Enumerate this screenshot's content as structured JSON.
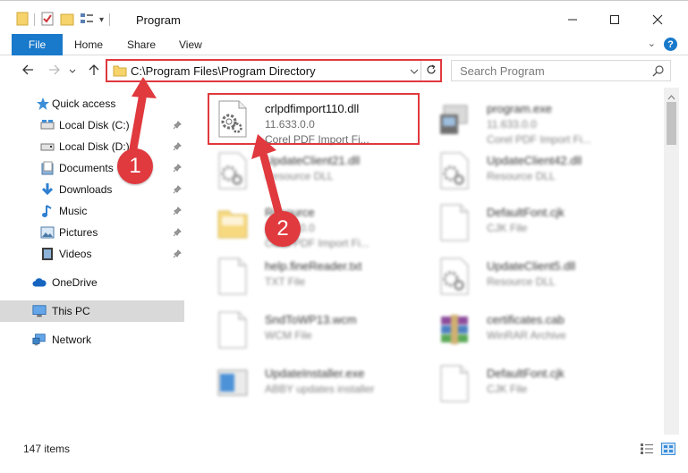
{
  "window": {
    "title": "Program",
    "qat_dropdown": "▾",
    "controls": {
      "minimize": "—",
      "maximize": "☐",
      "close": "✕"
    }
  },
  "ribbon": {
    "file_tab": "File",
    "tabs": [
      "Home",
      "Share",
      "View"
    ],
    "help": "?",
    "expand": "⌄"
  },
  "nav": {
    "address_path": "C:\\Program Files\\Program Directory",
    "search_placeholder": "Search Program"
  },
  "sidebar": {
    "items": [
      {
        "label": "Quick access",
        "icon": "star-icon",
        "pinned": false
      },
      {
        "label": "Local Disk (C:)",
        "icon": "drive-icon",
        "pinned": true
      },
      {
        "label": "Local Disk (D:)",
        "icon": "drive-icon",
        "pinned": true
      },
      {
        "label": "Documents",
        "icon": "documents-icon",
        "pinned": true
      },
      {
        "label": "Downloads",
        "icon": "downloads-icon",
        "pinned": true
      },
      {
        "label": "Music",
        "icon": "music-icon",
        "pinned": true
      },
      {
        "label": "Pictures",
        "icon": "pictures-icon",
        "pinned": true
      },
      {
        "label": "Videos",
        "icon": "videos-icon",
        "pinned": true
      },
      {
        "label": "OneDrive",
        "icon": "cloud-icon",
        "pinned": false
      },
      {
        "label": "This PC",
        "icon": "computer-icon",
        "pinned": false,
        "selected": true
      },
      {
        "label": "Network",
        "icon": "network-icon",
        "pinned": false
      }
    ]
  },
  "files": [
    {
      "name": "crlpdfimport110.dll",
      "line2": "11.633.0.0",
      "line3": "Corel PDF Import Fi...",
      "icon": "dll-gear-icon",
      "highlighted": true
    },
    {
      "name": "program.exe",
      "line2": "11.633.0.0",
      "line3": "Corel PDF Import Fi...",
      "icon": "exe-icon",
      "blurred": true
    },
    {
      "name": "UpdateClient21.dll",
      "line2": "Resource DLL",
      "line3": "",
      "icon": "dll-gear-icon",
      "blurred": true
    },
    {
      "name": "UpdateClient42.dll",
      "line2": "Resource DLL",
      "line3": "",
      "icon": "dll-gear-icon",
      "blurred": true
    },
    {
      "name": "Resource",
      "line2": "11.633.0.0",
      "line3": "Corel PDF Import Fi...",
      "icon": "folder-icon",
      "blurred": true
    },
    {
      "name": "DefaultFont.cjk",
      "line2": "CJK File",
      "line3": "",
      "icon": "blank-file-icon",
      "blurred": true
    },
    {
      "name": "help.fineReader.txt",
      "line2": "TXT File",
      "line3": "",
      "icon": "blank-file-icon",
      "blurred": true
    },
    {
      "name": "UpdateClient5.dll",
      "line2": "Resource DLL",
      "line3": "",
      "icon": "dll-gear-icon",
      "blurred": true
    },
    {
      "name": "SndToWP13.wcm",
      "line2": "WCM File",
      "line3": "",
      "icon": "blank-file-icon",
      "blurred": true
    },
    {
      "name": "certificates.cab",
      "line2": "WinRAR Archive",
      "line3": "",
      "icon": "winrar-icon",
      "blurred": true
    },
    {
      "name": "UpdateInstaller.exe",
      "line2": "ABBY updates installer",
      "line3": "",
      "icon": "installer-icon",
      "blurred": true
    },
    {
      "name": "DefaultFont.cjk",
      "line2": "CJK File",
      "line3": "",
      "icon": "blank-file-icon",
      "blurred": true
    }
  ],
  "status": {
    "item_count": "147 items"
  },
  "callouts": {
    "step1": "1",
    "step2": "2",
    "color": "#e0393e"
  },
  "colors": {
    "accent": "#1979ca",
    "highlight": "#e0393e",
    "selected_bg": "#d9d9d9"
  }
}
